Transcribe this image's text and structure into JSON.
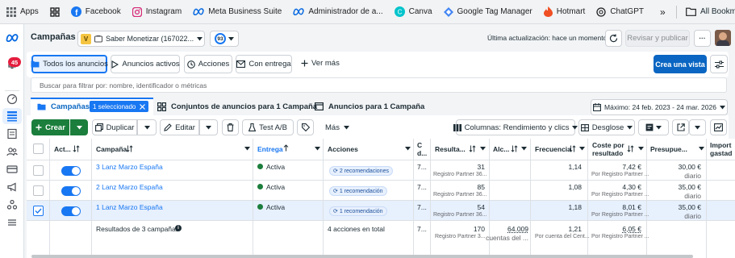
{
  "bookmarks": [
    {
      "icon": "apps-grid-icon",
      "label": "Apps"
    },
    {
      "icon": "grid-icon",
      "label": ""
    },
    {
      "icon": "facebook-icon",
      "label": "Facebook"
    },
    {
      "icon": "instagram-icon",
      "label": "Instagram"
    },
    {
      "icon": "meta-icon",
      "label": "Meta Business Suite"
    },
    {
      "icon": "meta-icon",
      "label": "Administrador de a..."
    },
    {
      "icon": "canva-icon",
      "label": "Canva"
    },
    {
      "icon": "tag-manager-icon",
      "label": "Google Tag Manager"
    },
    {
      "icon": "hotmart-icon",
      "label": "Hotmart"
    },
    {
      "icon": "chatgpt-icon",
      "label": "ChatGPT"
    }
  ],
  "bookmarks_overflow": "»",
  "all_bookmarks": "All Bookma",
  "rail_badge": "45",
  "header": {
    "title": "Campañas",
    "account_initial": "V",
    "account_name": "Saber Monetizar (167022...",
    "score": "93",
    "last_update": "Última actualización: hace un momento",
    "review_publish": "Revisar y publicar",
    "more": "···"
  },
  "filters": {
    "all_ads": "Todos los anuncios",
    "active_ads": "Anuncios activos",
    "actions": "Acciones",
    "with_delivery": "Con entrega",
    "see_more": "Ver más",
    "create_view": "Crea una vista"
  },
  "search": {
    "placeholder": "Buscar para filtrar por: nombre, identificador o métricas"
  },
  "tabs": {
    "campaigns": "Campañas",
    "selected": "1 seleccionado",
    "adsets": "Conjuntos de anuncios para 1 Campaña",
    "ads": "Anuncios para 1 Campaña",
    "date_range": "Máximo: 24 feb. 2023 - 24 mar. 2026"
  },
  "toolbar": {
    "create": "Crear",
    "duplicate": "Duplicar",
    "edit": "Editar",
    "ab_test": "Test A/B",
    "more": "Más",
    "columns": "Columnas: Rendimiento y clics",
    "breakdown": "Desglose"
  },
  "table": {
    "headers": {
      "activation": "Act...",
      "campaign": "Campaña",
      "delivery": "Entrega",
      "actions": "Acciones",
      "c_col_1": "C",
      "c_col_2": "d...",
      "results": "Resulta...",
      "reach": "Alc...",
      "frequency": "Frecuencia",
      "cost_1": "Coste por",
      "cost_2": "resultado",
      "budget": "Presupue...",
      "spent_1": "Import",
      "spent_2": "gastad"
    },
    "rows": [
      {
        "name": "3 Lanz Marzo España",
        "delivery": "Activa",
        "recs": "2 recomendaciones",
        "c": "7...",
        "results": "31",
        "results_sub": "Registro Partner 36...",
        "reach": "",
        "frequency": "1,14",
        "cost": "7,42 €",
        "cost_sub": "Por Registro Partner ...",
        "budget": "30,00 €",
        "budget_sub": "diario",
        "checked": false
      },
      {
        "name": "2 Lanz Marzo España",
        "delivery": "Activa",
        "recs": "1 recomendación",
        "c": "7...",
        "results": "85",
        "results_sub": "Registro Partner 36...",
        "reach": "",
        "frequency": "1,08",
        "cost": "4,30 €",
        "cost_sub": "Por Registro Partner ...",
        "budget": "35,00 €",
        "budget_sub": "diario",
        "checked": false
      },
      {
        "name": "1 Lanz Marzo España",
        "delivery": "Activa",
        "recs": "1 recomendación",
        "c": "7...",
        "results": "54",
        "results_sub": "Registro Partner 36...",
        "reach": "",
        "frequency": "1,18",
        "cost": "8,01 €",
        "cost_sub": "Por Registro Partner ...",
        "budget": "35,00 €",
        "budget_sub": "diario",
        "checked": true
      }
    ],
    "totals": {
      "label": "Resultados de 3 campañas",
      "actions": "4 acciones en total",
      "c": "7...",
      "results": "170",
      "results_sub": "Registro Partner 3...",
      "reach": "64.009",
      "reach_sub": "cuentas del ...",
      "frequency": "1,21",
      "frequency_sub": "Por cuenta del Cent...",
      "cost": "6,05 €",
      "cost_sub": "Por Registro Partner ..."
    }
  },
  "colors": {
    "accent": "#1877f2",
    "create_green": "#1b7e3c",
    "active_dot": "#1c7e3d"
  }
}
